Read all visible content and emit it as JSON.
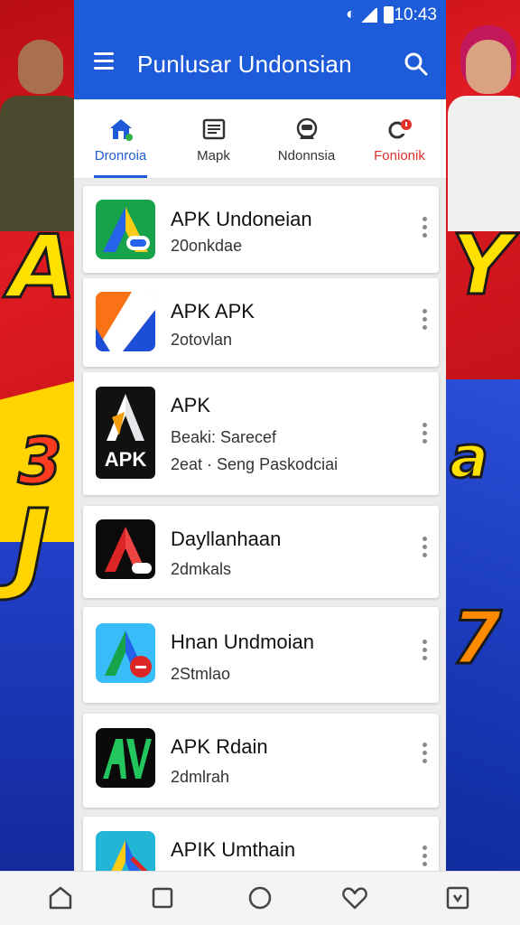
{
  "status_bar": {
    "time": "10:43"
  },
  "app_bar": {
    "title": "Punlusar Undonsian"
  },
  "tabs": [
    {
      "label": "Dronroia",
      "icon": "home-icon",
      "active": true
    },
    {
      "label": "Mapk",
      "icon": "list-icon"
    },
    {
      "label": "Ndonnsia",
      "icon": "robot-icon"
    },
    {
      "label": "Fonionik",
      "icon": "notification-icon",
      "accent": "#e0312a"
    }
  ],
  "apps": [
    {
      "name": "APK Undoneian",
      "subtitle": "20onkdae"
    },
    {
      "name": "APK APK",
      "subtitle": "2otovlan"
    },
    {
      "name": "APK",
      "subtitle": "Beaki: Sarecef",
      "subtitle2": "2eat · Seng Paskodciai",
      "icon_label": "APK"
    },
    {
      "name": "Dayllanhaan",
      "subtitle": "2dmkals"
    },
    {
      "name": "Hnan Undmoian",
      "subtitle": "2Stmlao"
    },
    {
      "name": "APK Rdain",
      "subtitle": "2dmlrah"
    },
    {
      "name": "APIK Umthain",
      "subtitle": ""
    }
  ],
  "colors": {
    "primary": "#1e5bd8",
    "accent_red": "#e0312a"
  }
}
